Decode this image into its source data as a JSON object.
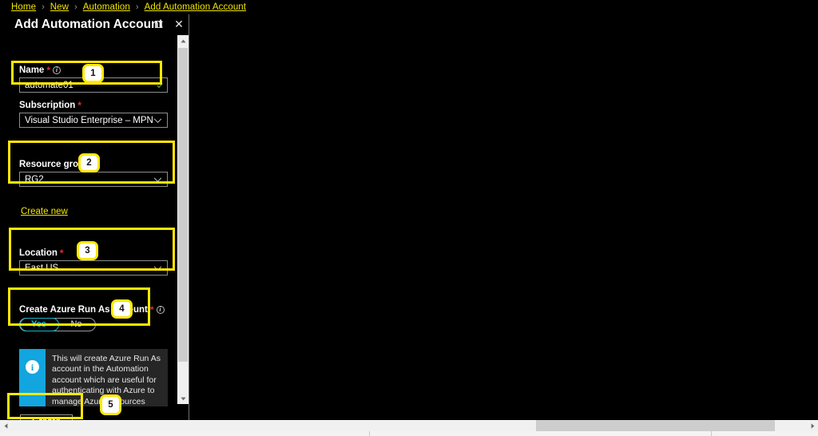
{
  "breadcrumb": {
    "items": [
      {
        "label": "Home"
      },
      {
        "label": "New"
      },
      {
        "label": "Automation"
      },
      {
        "label": "Add Automation Account"
      }
    ],
    "separator": "›"
  },
  "blade": {
    "title": "Add Automation Account",
    "maximize_label": "Maximize",
    "close_label": "✕"
  },
  "form": {
    "name": {
      "label": "Name",
      "required_marker": "*",
      "info_glyph": "i",
      "value": "automate01",
      "placeholder": "Name",
      "validation": "valid"
    },
    "subscription": {
      "label": "Subscription",
      "required_marker": "*",
      "value": "Visual Studio Enterprise – MPN"
    },
    "resource_group": {
      "label": "Resource group",
      "required_marker": "*",
      "value": "RG2",
      "create_new_link": "Create new"
    },
    "location": {
      "label": "Location",
      "required_marker": "*",
      "value": "East US"
    },
    "run_as": {
      "label": "Create Azure Run As account",
      "required_marker": "*",
      "info_glyph": "i",
      "options": [
        {
          "label": "Yes",
          "selected": true
        },
        {
          "label": "No",
          "selected": false
        }
      ]
    },
    "callout": {
      "icon_glyph": "i",
      "text": "This will create Azure Run As account in the Automation account which are useful for authenticating with Azure to manage Azure resources from"
    }
  },
  "footer": {
    "create_label": "Create"
  },
  "annotations": {
    "badges": [
      {
        "number": "1"
      },
      {
        "number": "2"
      },
      {
        "number": "3"
      },
      {
        "number": "4"
      },
      {
        "number": "5"
      }
    ],
    "highlight_color": "#ffe800"
  },
  "colors": {
    "background": "#000000",
    "breadcrumb_link": "#f2e600",
    "accent_teal": "#17c8d4",
    "callout_blue": "#12a5e0",
    "required_red": "#e02f2f",
    "highlight_yellow": "#ffe800"
  }
}
